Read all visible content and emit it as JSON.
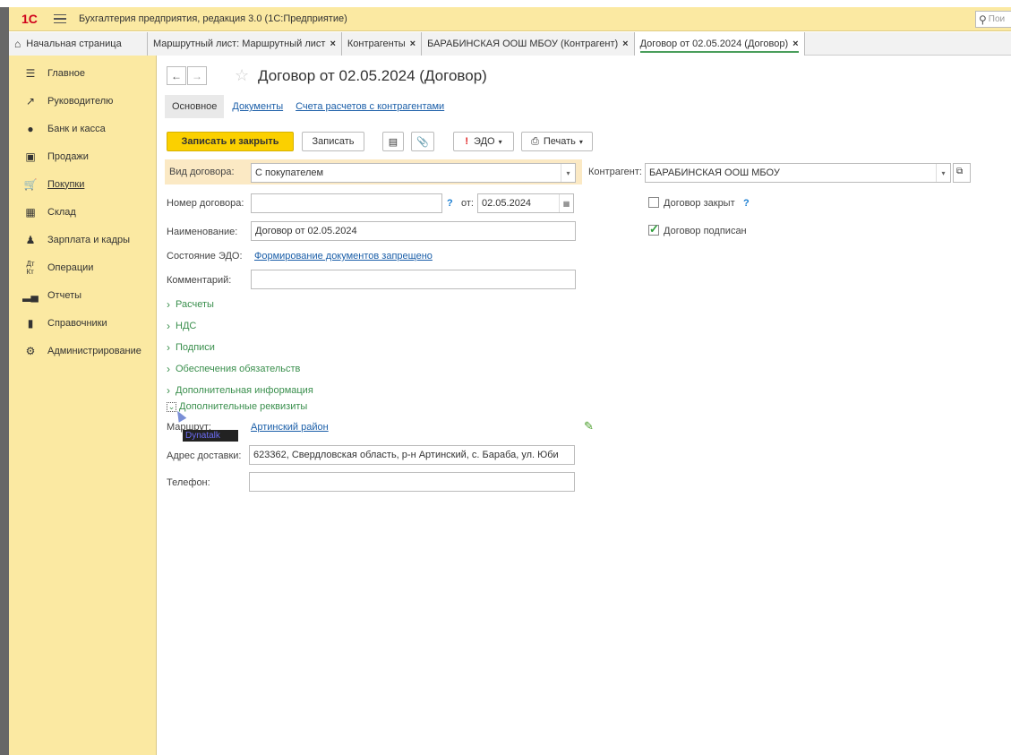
{
  "app": {
    "logo": "1С",
    "title": "Бухгалтерия предприятия, редакция 3.0  (1С:Предприятие)",
    "search_placeholder": "Пои"
  },
  "tabs": [
    {
      "label": "Начальная страница",
      "closable": false
    },
    {
      "label": "Маршрутный лист: Маршрутный лист",
      "closable": true
    },
    {
      "label": "Контрагенты",
      "closable": true
    },
    {
      "label": "БАРАБИНСКАЯ ООШ МБОУ (Контрагент)",
      "closable": true
    },
    {
      "label": "Договор от 02.05.2024 (Договор)",
      "closable": true,
      "active": true
    }
  ],
  "close_glyph": "×",
  "sidebar": {
    "items": [
      {
        "label": "Главное",
        "icon": "menu-lines-icon"
      },
      {
        "label": "Руководителю",
        "icon": "trend-icon"
      },
      {
        "label": "Банк и касса",
        "icon": "coin-icon"
      },
      {
        "label": "Продажи",
        "icon": "bag-icon"
      },
      {
        "label": "Покупки",
        "icon": "cart-icon"
      },
      {
        "label": "Склад",
        "icon": "warehouse-icon"
      },
      {
        "label": "Зарплата и кадры",
        "icon": "person-icon"
      },
      {
        "label": "Операции",
        "icon": "dt-kt-icon"
      },
      {
        "label": "Отчеты",
        "icon": "bar-chart-icon"
      },
      {
        "label": "Справочники",
        "icon": "book-icon"
      },
      {
        "label": "Администрирование",
        "icon": "gear-icon"
      }
    ]
  },
  "form": {
    "title": "Договор от 02.05.2024 (Договор)",
    "subtabs": {
      "main": "Основное",
      "documents": "Документы",
      "accounts": "Счета расчетов с контрагентами"
    },
    "toolbar": {
      "save_close": "Записать и закрыть",
      "save": "Записать",
      "edo": "ЭДО",
      "print": "Печать"
    },
    "contract_type": {
      "label": "Вид договора:",
      "value": "С покупателем"
    },
    "counterparty": {
      "label": "Контрагент:",
      "value": "БАРАБИНСКАЯ ООШ МБОУ"
    },
    "number": {
      "label": "Номер договора:",
      "value": "",
      "help": "?",
      "from_label": "от:",
      "date": "02.05.2024"
    },
    "closed": {
      "label": "Договор закрыт",
      "checked": false,
      "help": "?"
    },
    "signed": {
      "label": "Договор подписан",
      "checked": true
    },
    "name": {
      "label": "Наименование:",
      "value": "Договор от 02.05.2024"
    },
    "edo_state": {
      "label": "Состояние ЭДО:",
      "value": "Формирование документов запрещено"
    },
    "comment": {
      "label": "Комментарий:",
      "value": ""
    },
    "sections": [
      "Расчеты",
      "НДС",
      "Подписи",
      "Обеспечения обязательств",
      "Дополнительная информация"
    ],
    "extra_section": "Дополнительные реквизиты",
    "route": {
      "label": "Маршрут:",
      "value": "Артинский район"
    },
    "delivery": {
      "label": "Адрес доставки:",
      "value": "623362, Свердловская область, р-н Артинский, с. Бараба, ул. Юби"
    },
    "phone": {
      "label": "Телефон:",
      "value": ""
    },
    "tooltip": "Dynatalk"
  }
}
